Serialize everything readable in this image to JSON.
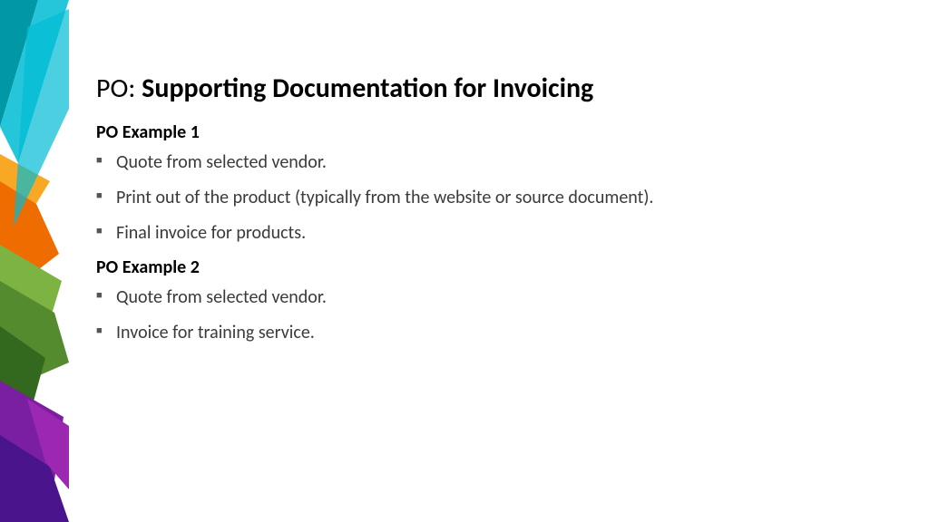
{
  "title": {
    "prefix": "PO: ",
    "main": "Supporting Documentation for Invoicing"
  },
  "sections": [
    {
      "heading": "PO Example 1",
      "items": [
        "Quote from selected vendor.",
        "Print out of the product (typically from the website or source document).",
        "Final invoice for products."
      ]
    },
    {
      "heading": "PO Example 2",
      "items": [
        "Quote from selected vendor.",
        "Invoice for training service."
      ]
    }
  ]
}
